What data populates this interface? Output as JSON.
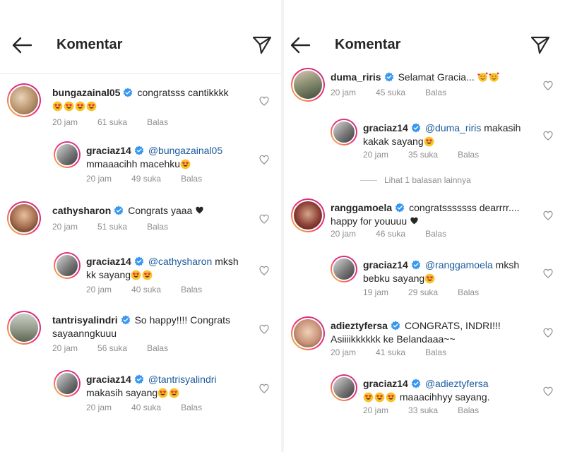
{
  "header_title": "Komentar",
  "left": {
    "c1": {
      "user": "bungazainal05",
      "text": "congratsss cantikkkk",
      "time": "20 jam",
      "likes": "61 suka",
      "reply": "Balas"
    },
    "r1": {
      "user": "graciaz14",
      "mention": "@bungazainal05",
      "text": "mmaaacihh macehku",
      "time": "20 jam",
      "likes": "49 suka",
      "reply": "Balas"
    },
    "c2": {
      "user": "cathysharon",
      "text": "Congrats yaaa",
      "time": "20 jam",
      "likes": "51 suka",
      "reply": "Balas"
    },
    "r2": {
      "user": "graciaz14",
      "mention": "@cathysharon",
      "text_a": "mksh",
      "text_b": "kk sayang",
      "time": "20 jam",
      "likes": "40 suka",
      "reply": "Balas"
    },
    "c3": {
      "user": "tantrisyalindri",
      "text_a": "So happy!!!! Congrats",
      "text_b": "sayaanngkuuu",
      "time": "20 jam",
      "likes": "56 suka",
      "reply": "Balas"
    },
    "r3": {
      "user": "graciaz14",
      "mention": "@tantrisyalindri",
      "text": "makasih sayang",
      "time": "20 jam",
      "likes": "40 suka",
      "reply": "Balas"
    }
  },
  "right": {
    "c1": {
      "user": "duma_riris",
      "text": "Selamat Gracia...",
      "time": "20 jam",
      "likes": "45 suka",
      "reply": "Balas"
    },
    "r1": {
      "user": "graciaz14",
      "mention": "@duma_riris",
      "text_a": "makasih",
      "text_b": "kakak sayang",
      "time": "20 jam",
      "likes": "35 suka",
      "reply": "Balas"
    },
    "view_more": "Lihat 1 balasan lainnya",
    "c2": {
      "user": "ranggamoela",
      "text_a": "congratsssssss dearrrr....",
      "text_b": "happy for youuuu",
      "time": "20 jam",
      "likes": "46 suka",
      "reply": "Balas"
    },
    "r2": {
      "user": "graciaz14",
      "mention": "@ranggamoela",
      "text_a": "mksh",
      "text_b": "bebku sayang",
      "time": "19 jam",
      "likes": "29 suka",
      "reply": "Balas"
    },
    "c3": {
      "user": "adieztyfersa",
      "text_a": "CONGRATS, INDRI!!!",
      "text_b": "Asiiiikkkkkk ke Belandaaa~~",
      "time": "20 jam",
      "likes": "41 suka",
      "reply": "Balas"
    },
    "r3": {
      "user": "graciaz14",
      "mention": "@adieztyfersa",
      "text": "maaacihhyy sayang.",
      "time": "20 jam",
      "likes": "33 suka",
      "reply": "Balas"
    }
  },
  "colors": {
    "accent": "#1b5a9c",
    "verified": "#3897f0",
    "muted": "#8e8e8e"
  },
  "icons": [
    "back-arrow-icon",
    "send-icon",
    "verified-badge-icon",
    "heart-outline-icon",
    "heart-eyes-emoji-icon",
    "black-heart-icon",
    "smiling-hearts-emoji-icon"
  ]
}
